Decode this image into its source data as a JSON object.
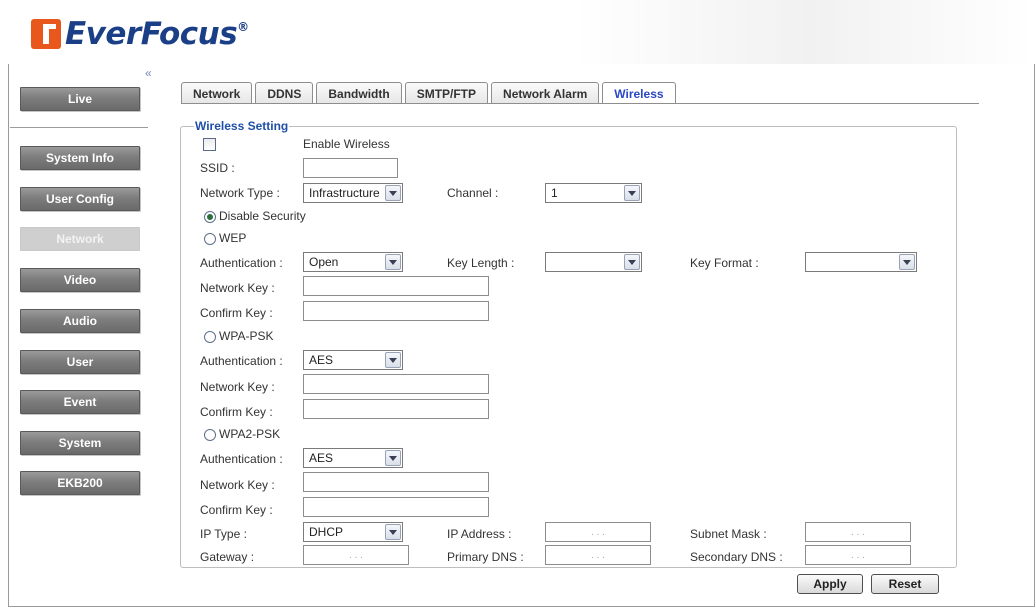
{
  "brand": {
    "name": "EverFocus",
    "trademark": "®"
  },
  "sidebar": {
    "collapse_glyph": "«",
    "live": "Live",
    "items": [
      {
        "label": "System Info"
      },
      {
        "label": "User Config"
      },
      {
        "label": "Network",
        "active": true
      },
      {
        "label": "Video"
      },
      {
        "label": "Audio"
      },
      {
        "label": "User"
      },
      {
        "label": "Event"
      },
      {
        "label": "System"
      },
      {
        "label": "EKB200"
      }
    ]
  },
  "tabs": [
    {
      "label": "Network"
    },
    {
      "label": "DDNS"
    },
    {
      "label": "Bandwidth"
    },
    {
      "label": "SMTP/FTP"
    },
    {
      "label": "Network Alarm"
    },
    {
      "label": "Wireless",
      "active": true
    }
  ],
  "wireless": {
    "legend": "Wireless Setting",
    "enable_label": "Enable Wireless",
    "enabled": false,
    "ssid_label": "SSID :",
    "ssid_value": "",
    "network_type_label": "Network Type :",
    "network_type_value": "Infrastructure",
    "channel_label": "Channel :",
    "channel_value": "1",
    "security_mode": "Disable Security",
    "disable_security_label": "Disable Security",
    "wep": {
      "label": "WEP",
      "auth_label": "Authentication :",
      "auth_value": "Open",
      "key_length_label": "Key Length :",
      "key_length_value": "",
      "key_format_label": "Key Format :",
      "key_format_value": "",
      "network_key_label": "Network Key :",
      "confirm_key_label": "Confirm Key :"
    },
    "wpa_psk": {
      "label": "WPA-PSK",
      "auth_label": "Authentication :",
      "auth_value": "AES",
      "network_key_label": "Network Key :",
      "confirm_key_label": "Confirm Key :"
    },
    "wpa2_psk": {
      "label": "WPA2-PSK",
      "auth_label": "Authentication :",
      "auth_value": "AES",
      "network_key_label": "Network Key :",
      "confirm_key_label": "Confirm Key :"
    },
    "ip_type_label": "IP Type :",
    "ip_type_value": "DHCP",
    "ip_address_label": "IP Address :",
    "subnet_mask_label": "Subnet Mask :",
    "gateway_label": "Gateway :",
    "primary_dns_label": "Primary DNS :",
    "secondary_dns_label": "Secondary DNS :",
    "ip_dots": ". . ."
  },
  "actions": {
    "apply": "Apply",
    "reset": "Reset"
  }
}
